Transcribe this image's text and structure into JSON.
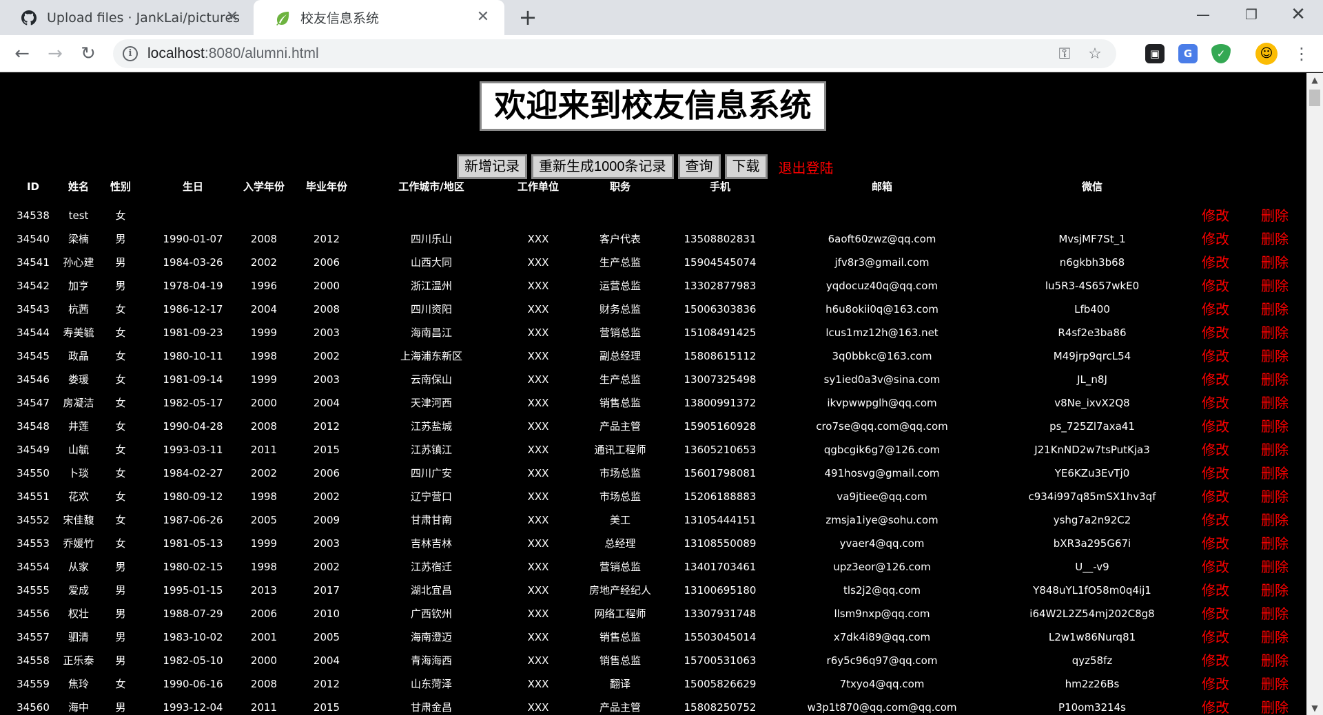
{
  "browser": {
    "tabs": [
      {
        "title": "Upload files · JankLai/pictures",
        "icon": "github-icon"
      },
      {
        "title": "校友信息系统",
        "icon": "leaf-icon"
      }
    ],
    "url_host": "localhost",
    "url_rest": ":8080/alumni.html"
  },
  "page": {
    "title": "欢迎来到校友信息系统",
    "buttons": {
      "add": "新增记录",
      "regen": "重新生成1000条记录",
      "query": "查询",
      "download": "下载"
    },
    "logout": "退出登陆",
    "edit_label": "修改",
    "delete_label": "删除"
  },
  "table": {
    "headers": [
      "ID",
      "姓名",
      "性别",
      "生日",
      "入学年份",
      "毕业年份",
      "工作城市/地区",
      "工作单位",
      "职务",
      "手机",
      "邮箱",
      "微信"
    ],
    "rows": [
      [
        "34538",
        "test",
        "女",
        "",
        "",
        "",
        "",
        "",
        "",
        "",
        "",
        ""
      ],
      [
        "34540",
        "梁楠",
        "男",
        "1990-01-07",
        "2008",
        "2012",
        "四川乐山",
        "XXX",
        "客户代表",
        "13508802831",
        "6aoft60zwz@qq.com",
        "MvsjMF7St_1"
      ],
      [
        "34541",
        "孙心建",
        "男",
        "1984-03-26",
        "2002",
        "2006",
        "山西大同",
        "XXX",
        "生产总监",
        "15904545074",
        "jfv8r3@gmail.com",
        "n6gkbh3b68"
      ],
      [
        "34542",
        "加亨",
        "男",
        "1978-04-19",
        "1996",
        "2000",
        "浙江温州",
        "XXX",
        "运营总监",
        "13302877983",
        "yqdocuz40q@qq.com",
        "lu5R3-4S657wkE0"
      ],
      [
        "34543",
        "杭茜",
        "女",
        "1986-12-17",
        "2004",
        "2008",
        "四川资阳",
        "XXX",
        "财务总监",
        "15006303836",
        "h6u8okii0q@163.com",
        "Lfb400"
      ],
      [
        "34544",
        "寿美毓",
        "女",
        "1981-09-23",
        "1999",
        "2003",
        "海南昌江",
        "XXX",
        "营销总监",
        "15108491425",
        "lcus1mz12h@163.net",
        "R4sf2e3ba86"
      ],
      [
        "34545",
        "政晶",
        "女",
        "1980-10-11",
        "1998",
        "2002",
        "上海浦东新区",
        "XXX",
        "副总经理",
        "15808615112",
        "3q0bbkc@163.com",
        "M49jrp9qrcL54"
      ],
      [
        "34546",
        "娄瑗",
        "女",
        "1981-09-14",
        "1999",
        "2003",
        "云南保山",
        "XXX",
        "生产总监",
        "13007325498",
        "sy1ied0a3v@sina.com",
        "JL_n8J"
      ],
      [
        "34547",
        "房凝洁",
        "女",
        "1982-05-17",
        "2000",
        "2004",
        "天津河西",
        "XXX",
        "销售总监",
        "13800991372",
        "ikvpwwpglh@qq.com",
        "v8Ne_ixvX2Q8"
      ],
      [
        "34548",
        "井莲",
        "女",
        "1990-04-28",
        "2008",
        "2012",
        "江苏盐城",
        "XXX",
        "产品主管",
        "15905160928",
        "cro7se@qq.com@qq.com",
        "ps_725Zl7axa41"
      ],
      [
        "34549",
        "山毓",
        "女",
        "1993-03-11",
        "2011",
        "2015",
        "江苏镇江",
        "XXX",
        "通讯工程师",
        "13605210653",
        "qgbcgik6g7@126.com",
        "J21KnND2w7tsPutKja3"
      ],
      [
        "34550",
        "卜琰",
        "女",
        "1984-02-27",
        "2002",
        "2006",
        "四川广安",
        "XXX",
        "市场总监",
        "15601798081",
        "491hosvg@gmail.com",
        "YE6KZu3EvTj0"
      ],
      [
        "34551",
        "花欢",
        "女",
        "1980-09-12",
        "1998",
        "2002",
        "辽宁营口",
        "XXX",
        "市场总监",
        "15206188883",
        "va9jtiee@qq.com",
        "c934i997q85mSX1hv3qf"
      ],
      [
        "34552",
        "宋佳馥",
        "女",
        "1987-06-26",
        "2005",
        "2009",
        "甘肃甘南",
        "XXX",
        "美工",
        "13105444151",
        "zmsja1iye@sohu.com",
        "yshg7a2n92C2"
      ],
      [
        "34553",
        "乔媛竹",
        "女",
        "1981-05-13",
        "1999",
        "2003",
        "吉林吉林",
        "XXX",
        "总经理",
        "13108550089",
        "yvaer4@qq.com",
        "bXR3a295G67i"
      ],
      [
        "34554",
        "从家",
        "男",
        "1980-02-15",
        "1998",
        "2002",
        "江苏宿迁",
        "XXX",
        "营销总监",
        "13401703461",
        "upz3eor@126.com",
        "U__-v9"
      ],
      [
        "34555",
        "爱成",
        "男",
        "1995-01-15",
        "2013",
        "2017",
        "湖北宜昌",
        "XXX",
        "房地产经纪人",
        "13100695180",
        "tls2j2@qq.com",
        "Y848uYL1fO58m0q4ij1"
      ],
      [
        "34556",
        "权壮",
        "男",
        "1988-07-29",
        "2006",
        "2010",
        "广西钦州",
        "XXX",
        "网络工程师",
        "13307931748",
        "llsm9nxp@qq.com",
        "i64W2L2Z54mj202C8g8"
      ],
      [
        "34557",
        "驷清",
        "男",
        "1983-10-02",
        "2001",
        "2005",
        "海南澄迈",
        "XXX",
        "销售总监",
        "15503045014",
        "x7dk4i89@qq.com",
        "L2w1w86Nurq81"
      ],
      [
        "34558",
        "正乐泰",
        "男",
        "1982-05-10",
        "2000",
        "2004",
        "青海海西",
        "XXX",
        "销售总监",
        "15700531063",
        "r6y5c96q97@qq.com",
        "qyz58fz"
      ],
      [
        "34559",
        "焦玲",
        "女",
        "1990-06-16",
        "2008",
        "2012",
        "山东菏泽",
        "XXX",
        "翻译",
        "15005826629",
        "7txyo4@qq.com",
        "hm2z26Bs"
      ],
      [
        "34560",
        "海中",
        "男",
        "1993-12-04",
        "2011",
        "2015",
        "甘肃金昌",
        "XXX",
        "产品主管",
        "15808250752",
        "w3p1t870@qq.com@qq.com",
        "P10om3214s"
      ]
    ]
  },
  "colors": {
    "page_bg": "#000000",
    "action_red": "#ff0000",
    "button_gray": "#d6d6d6"
  }
}
